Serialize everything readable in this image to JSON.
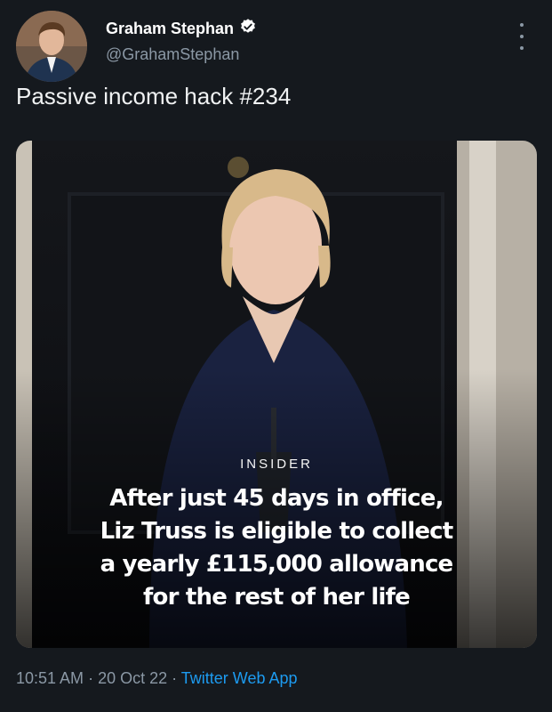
{
  "author": {
    "name": "Graham Stephan",
    "handle": "@GrahamStephan",
    "verified": true
  },
  "tweet": {
    "text": "Passive income hack #234"
  },
  "media": {
    "brand": "INSIDER",
    "headline_lines": [
      "After just 45 days in office,",
      "Liz Truss is eligible to collect",
      "a yearly £115,000 allowance",
      "for the rest of her life"
    ]
  },
  "meta": {
    "time": "10:51 AM",
    "sep1": " · ",
    "date": "20 Oct 22",
    "sep2": " · ",
    "app": "Twitter Web App"
  },
  "colors": {
    "background": "#15191e",
    "link": "#1d9bf0",
    "secondary_text": "#8b98a5"
  }
}
